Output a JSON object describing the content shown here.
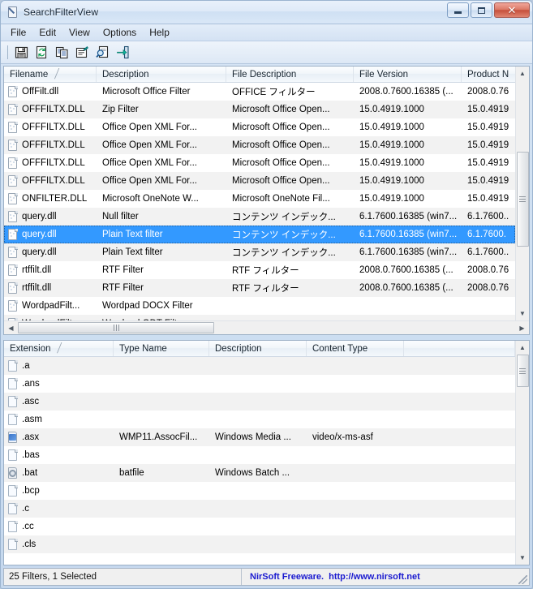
{
  "window": {
    "title": "SearchFilterView",
    "icon": "app-document-pen-icon",
    "buttons": {
      "minimize": "minimize",
      "maximize": "maximize",
      "close": "close"
    }
  },
  "menu": [
    {
      "label": "File"
    },
    {
      "label": "Edit"
    },
    {
      "label": "View"
    },
    {
      "label": "Options"
    },
    {
      "label": "Help"
    }
  ],
  "toolbar": [
    {
      "name": "save-icon",
      "title": "Save"
    },
    {
      "name": "refresh-icon",
      "title": "Refresh"
    },
    {
      "name": "copy-icon",
      "title": "Copy"
    },
    {
      "name": "properties-icon",
      "title": "Properties"
    },
    {
      "name": "find-icon",
      "title": "Find"
    },
    {
      "name": "exit-icon",
      "title": "Exit"
    }
  ],
  "filters_list": {
    "columns": [
      {
        "label": "Filename",
        "sorted": true,
        "sort_glyph": "╱",
        "width": 114
      },
      {
        "label": "Description",
        "sorted": false,
        "width": 160
      },
      {
        "label": "File Description",
        "sorted": false,
        "width": 157
      },
      {
        "label": "File Version",
        "sorted": false,
        "width": 133
      },
      {
        "label": "Product N",
        "sorted": false,
        "width": 85
      }
    ],
    "rows": [
      {
        "filename": "OffFilt.dll",
        "description": "Microsoft Office Filter",
        "file_description": "OFFICE フィルター",
        "file_version": "2008.0.7600.16385 (...",
        "product_name": "2008.0.76",
        "icon": "filter-dll-icon",
        "selected": false
      },
      {
        "filename": "OFFFILTX.DLL",
        "description": "Zip Filter",
        "file_description": "Microsoft Office Open...",
        "file_version": "15.0.4919.1000",
        "product_name": "15.0.4919",
        "icon": "filter-dll-icon",
        "selected": false
      },
      {
        "filename": "OFFFILTX.DLL",
        "description": "Office Open XML For...",
        "file_description": "Microsoft Office Open...",
        "file_version": "15.0.4919.1000",
        "product_name": "15.0.4919",
        "icon": "filter-dll-icon",
        "selected": false
      },
      {
        "filename": "OFFFILTX.DLL",
        "description": "Office Open XML For...",
        "file_description": "Microsoft Office Open...",
        "file_version": "15.0.4919.1000",
        "product_name": "15.0.4919",
        "icon": "filter-dll-icon",
        "selected": false
      },
      {
        "filename": "OFFFILTX.DLL",
        "description": "Office Open XML For...",
        "file_description": "Microsoft Office Open...",
        "file_version": "15.0.4919.1000",
        "product_name": "15.0.4919",
        "icon": "filter-dll-icon",
        "selected": false
      },
      {
        "filename": "OFFFILTX.DLL",
        "description": "Office Open XML For...",
        "file_description": "Microsoft Office Open...",
        "file_version": "15.0.4919.1000",
        "product_name": "15.0.4919",
        "icon": "filter-dll-icon",
        "selected": false
      },
      {
        "filename": "ONFILTER.DLL",
        "description": "Microsoft OneNote W...",
        "file_description": "Microsoft OneNote Fil...",
        "file_version": "15.0.4919.1000",
        "product_name": "15.0.4919",
        "icon": "filter-dll-icon",
        "selected": false
      },
      {
        "filename": "query.dll",
        "description": "Null filter",
        "file_description": "コンテンツ インデック...",
        "file_version": "6.1.7600.16385 (win7...",
        "product_name": "6.1.7600..",
        "icon": "filter-dll-icon",
        "selected": false
      },
      {
        "filename": "query.dll",
        "description": "Plain Text filter",
        "file_description": "コンテンツ インデック...",
        "file_version": "6.1.7600.16385 (win7...",
        "product_name": "6.1.7600.",
        "icon": "filter-dll-icon",
        "selected": true
      },
      {
        "filename": "query.dll",
        "description": "Plain Text filter",
        "file_description": "コンテンツ インデック...",
        "file_version": "6.1.7600.16385 (win7...",
        "product_name": "6.1.7600..",
        "icon": "filter-dll-icon",
        "selected": false
      },
      {
        "filename": "rtffilt.dll",
        "description": "RTF Filter",
        "file_description": "RTF フィルター",
        "file_version": "2008.0.7600.16385 (...",
        "product_name": "2008.0.76",
        "icon": "filter-dll-icon",
        "selected": false
      },
      {
        "filename": "rtffilt.dll",
        "description": "RTF Filter",
        "file_description": "RTF フィルター",
        "file_version": "2008.0.7600.16385 (...",
        "product_name": "2008.0.76",
        "icon": "filter-dll-icon",
        "selected": false
      },
      {
        "filename": "WordpadFilt...",
        "description": "Wordpad DOCX Filter",
        "file_description": "",
        "file_version": "",
        "product_name": "",
        "icon": "filter-dll-icon",
        "selected": false
      },
      {
        "filename": "WordpadFilt...",
        "description": "Wordpad ODT Filter",
        "file_description": "",
        "file_version": "",
        "product_name": "",
        "icon": "filter-dll-icon",
        "selected": false
      }
    ]
  },
  "extensions_list": {
    "columns": [
      {
        "label": "Extension",
        "sorted": true,
        "sort_glyph": "╱",
        "width": 135
      },
      {
        "label": "Type Name",
        "sorted": false,
        "width": 118
      },
      {
        "label": "Description",
        "sorted": false,
        "width": 120
      },
      {
        "label": "Content Type",
        "sorted": false,
        "width": 120
      },
      {
        "label": "",
        "sorted": false,
        "width": 90
      }
    ],
    "rows": [
      {
        "extension": ".a",
        "type_name": "",
        "description": "",
        "content_type": "",
        "icon": "blank-file-icon"
      },
      {
        "extension": ".ans",
        "type_name": "",
        "description": "",
        "content_type": "",
        "icon": "blank-file-icon"
      },
      {
        "extension": ".asc",
        "type_name": "",
        "description": "",
        "content_type": "",
        "icon": "blank-file-icon"
      },
      {
        "extension": ".asm",
        "type_name": "",
        "description": "",
        "content_type": "",
        "icon": "blank-file-icon"
      },
      {
        "extension": ".asx",
        "type_name": "WMP11.AssocFil...",
        "description": "Windows Media ...",
        "content_type": "video/x-ms-asf",
        "icon": "media-file-icon"
      },
      {
        "extension": ".bas",
        "type_name": "",
        "description": "",
        "content_type": "",
        "icon": "blank-file-icon"
      },
      {
        "extension": ".bat",
        "type_name": "batfile",
        "description": "Windows Batch ...",
        "content_type": "",
        "icon": "batch-file-icon"
      },
      {
        "extension": ".bcp",
        "type_name": "",
        "description": "",
        "content_type": "",
        "icon": "blank-file-icon"
      },
      {
        "extension": ".c",
        "type_name": "",
        "description": "",
        "content_type": "",
        "icon": "blank-file-icon"
      },
      {
        "extension": ".cc",
        "type_name": "",
        "description": "",
        "content_type": "",
        "icon": "blank-file-icon"
      },
      {
        "extension": ".cls",
        "type_name": "",
        "description": "",
        "content_type": "",
        "icon": "blank-file-icon"
      }
    ]
  },
  "statusbar": {
    "count_text": "25 Filters, 1 Selected",
    "brand": "NirSoft Freeware.",
    "url": "http://www.nirsoft.net",
    "brand_color": "#1a1ad0"
  }
}
